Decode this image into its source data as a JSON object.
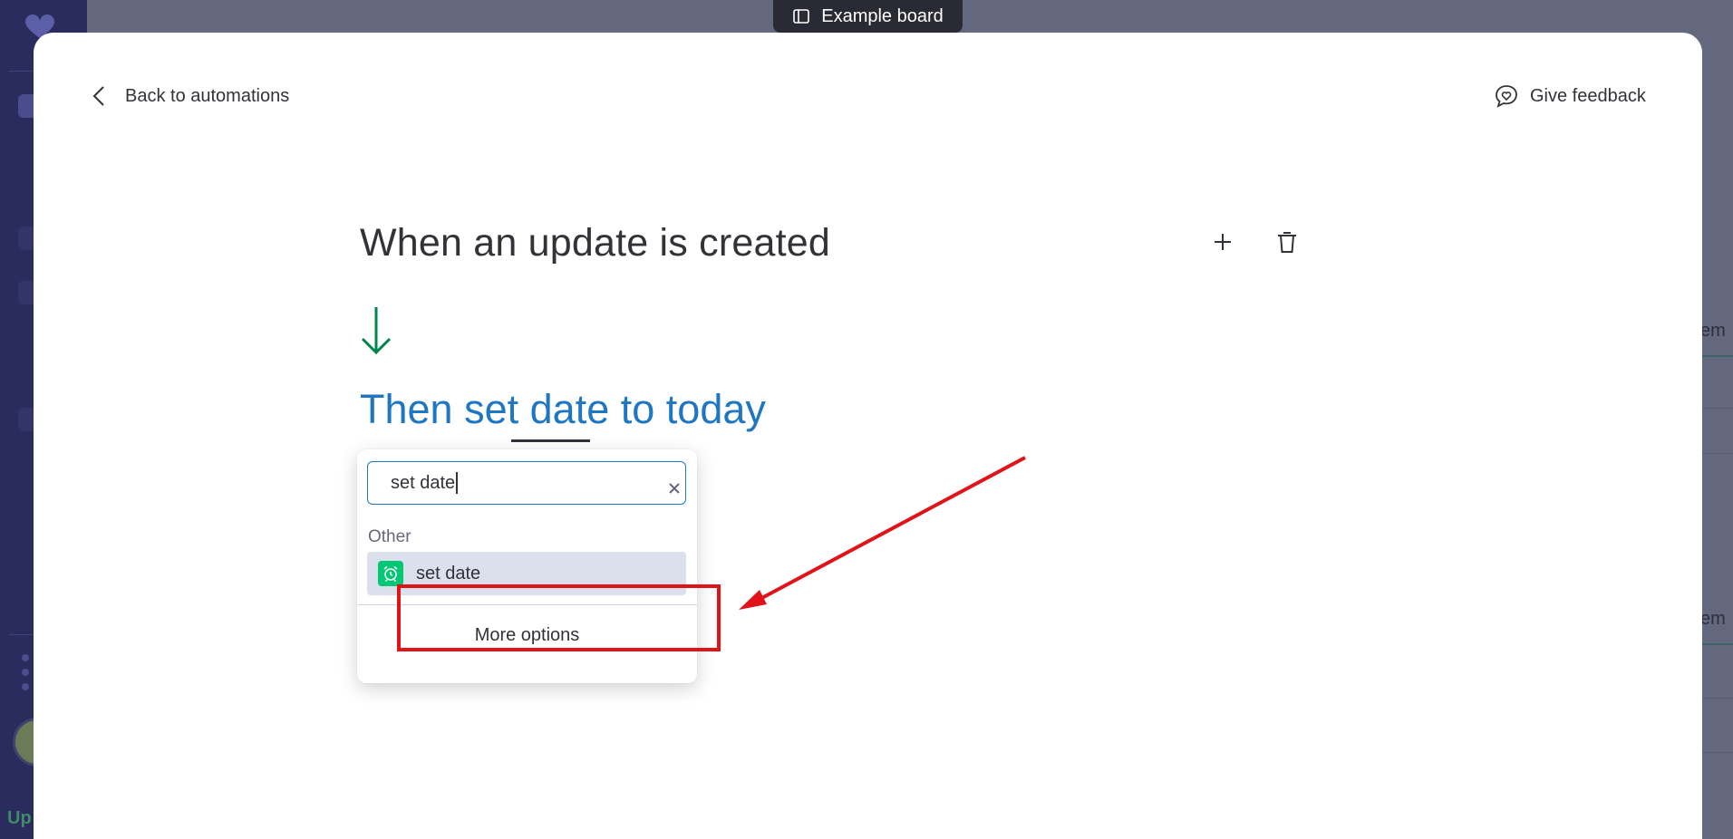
{
  "board_pill": {
    "label": "Example board",
    "icon": "board-layout-icon"
  },
  "modal": {
    "back_label": "Back to automations",
    "feedback_label": "Give feedback"
  },
  "recipe": {
    "trigger": "When an update is created",
    "action_words": {
      "then": "Then",
      "set": "set",
      "date": "date",
      "to": "to",
      "today": "today"
    }
  },
  "dropdown": {
    "search_value": "set date",
    "group_label": "Other",
    "option_label": "set date",
    "option_icon": "alarm-clock-icon",
    "more_options_label": "More options"
  },
  "colors": {
    "accent_blue": "#1f76c2",
    "arrow_green": "#00854d",
    "option_icon_green": "#00c875",
    "annotation_red": "#e01418"
  },
  "background": {
    "right_fragment_1": "em",
    "right_fragment_2": "em",
    "sidebar_fragment": "Up"
  }
}
